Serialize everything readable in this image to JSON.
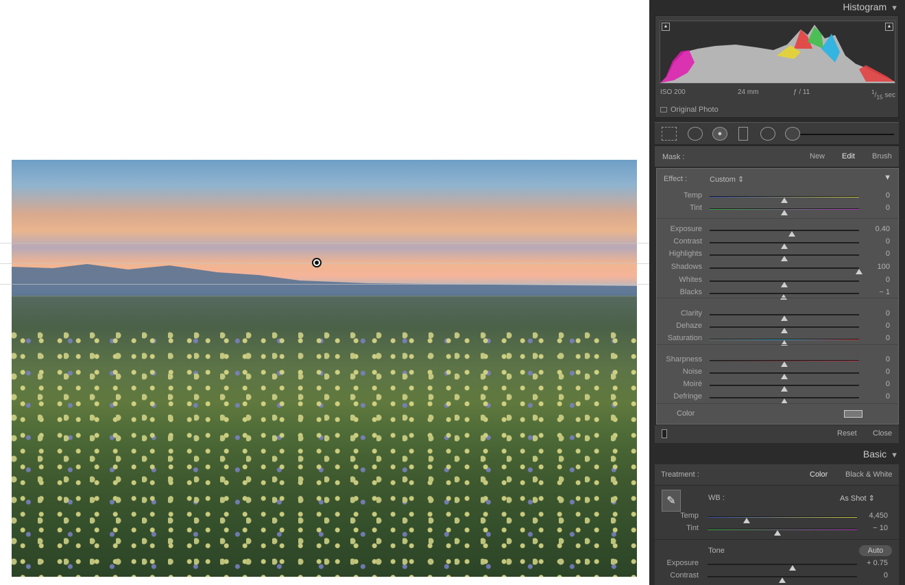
{
  "histogram": {
    "title": "Histogram",
    "iso": "ISO 200",
    "focal": "24 mm",
    "aperture": "ƒ / 11",
    "shutter_num": "1",
    "shutter_den": "15",
    "shutter_unit": "sec",
    "original_photo": "Original Photo"
  },
  "mask": {
    "label": "Mask :",
    "new": "New",
    "edit": "Edit",
    "brush": "Brush"
  },
  "effect": {
    "label": "Effect :",
    "value": "Custom"
  },
  "sliders": [
    {
      "name": "temp",
      "label": "Temp",
      "value": "0",
      "pos": 0.5
    },
    {
      "name": "tint",
      "label": "Tint",
      "value": "0",
      "pos": 0.5
    },
    {
      "name": "exposure",
      "label": "Exposure",
      "value": "0.40",
      "pos": 0.55
    },
    {
      "name": "contrast",
      "label": "Contrast",
      "value": "0",
      "pos": 0.5
    },
    {
      "name": "highlights",
      "label": "Highlights",
      "value": "0",
      "pos": 0.5
    },
    {
      "name": "shadows",
      "label": "Shadows",
      "value": "100",
      "pos": 1.0
    },
    {
      "name": "whites",
      "label": "Whites",
      "value": "0",
      "pos": 0.5
    },
    {
      "name": "blacks",
      "label": "Blacks",
      "value": "− 1",
      "pos": 0.495
    },
    {
      "name": "clarity",
      "label": "Clarity",
      "value": "0",
      "pos": 0.5
    },
    {
      "name": "dehaze",
      "label": "Dehaze",
      "value": "0",
      "pos": 0.5
    },
    {
      "name": "saturation",
      "label": "Saturation",
      "value": "0",
      "pos": 0.5
    },
    {
      "name": "sharpness",
      "label": "Sharpness",
      "value": "0",
      "pos": 0.5
    },
    {
      "name": "noise",
      "label": "Noise",
      "value": "0",
      "pos": 0.5
    },
    {
      "name": "moire",
      "label": "Moiré",
      "value": "0",
      "pos": 0.5
    },
    {
      "name": "defringe",
      "label": "Defringe",
      "value": "0",
      "pos": 0.5
    }
  ],
  "color_label": "Color",
  "reset": "Reset",
  "close": "Close",
  "basic": {
    "title": "Basic",
    "treatment_label": "Treatment :",
    "color": "Color",
    "bw": "Black & White",
    "wb_label": "WB :",
    "wb_value": "As Shot",
    "temp": {
      "label": "Temp",
      "value": "4,450",
      "pos": 0.26
    },
    "tint": {
      "label": "Tint",
      "value": "− 10",
      "pos": 0.47
    },
    "tone": "Tone",
    "auto": "Auto",
    "exposure": {
      "label": "Exposure",
      "value": "+ 0.75",
      "pos": 0.57
    },
    "contrast": {
      "label": "Contrast",
      "value": "0",
      "pos": 0.5
    }
  },
  "colors": {
    "panel": "#2b2b2b",
    "track": "#242424"
  }
}
